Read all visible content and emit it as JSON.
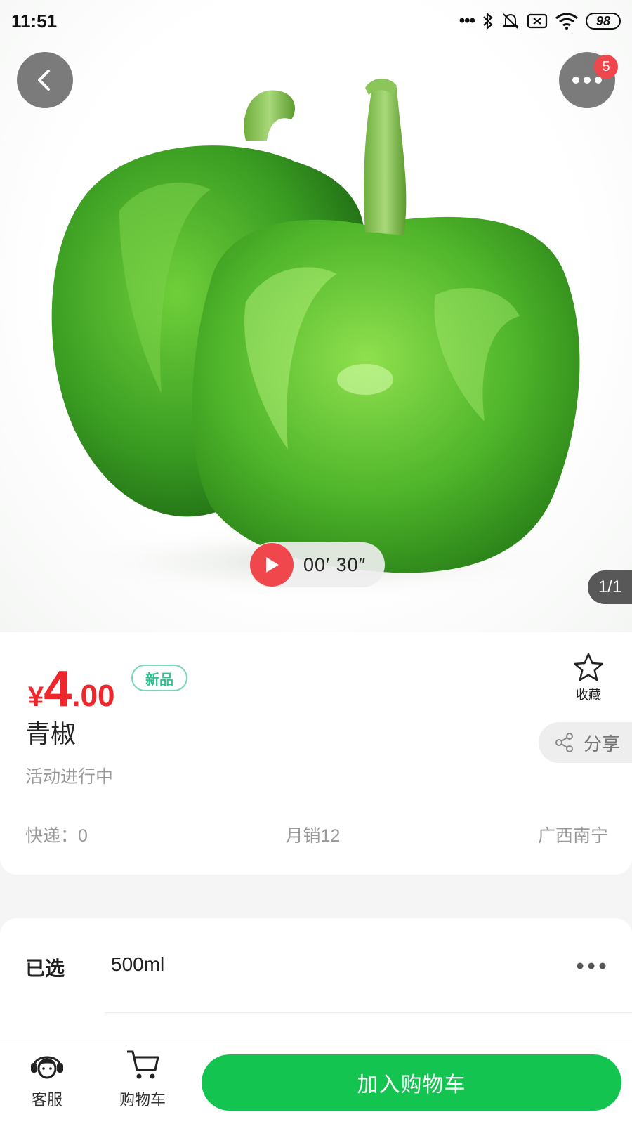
{
  "status_bar": {
    "time": "11:51",
    "battery": "98",
    "icons": [
      "more-dots-icon",
      "bluetooth-icon",
      "mute-bell-icon",
      "sim-x-icon",
      "wifi-icon",
      "battery-icon"
    ]
  },
  "hero": {
    "image_subject": "green-pepper",
    "more_badge_count": "5",
    "video_duration": "00′ 30″",
    "image_counter": "1/1"
  },
  "product": {
    "price_symbol": "¥",
    "price_integer": "4",
    "price_decimal": ".00",
    "new_tag": "新品",
    "favorite_label": "收藏",
    "name": "青椒",
    "share_label": "分享",
    "promo_text": "活动进行中",
    "shipping": "快递：0",
    "monthly_sales": "月销12",
    "location": "广西南宁"
  },
  "selection": {
    "label": "已选",
    "value": "500ml"
  },
  "bottom_bar": {
    "customer_service_label": "客服",
    "cart_label": "购物车",
    "add_to_cart_label": "加入购物车"
  },
  "colors": {
    "accent_green": "#14c451",
    "price_red": "#f0262d",
    "badge_red": "#f0474d",
    "tag_green": "#2fc08f"
  }
}
